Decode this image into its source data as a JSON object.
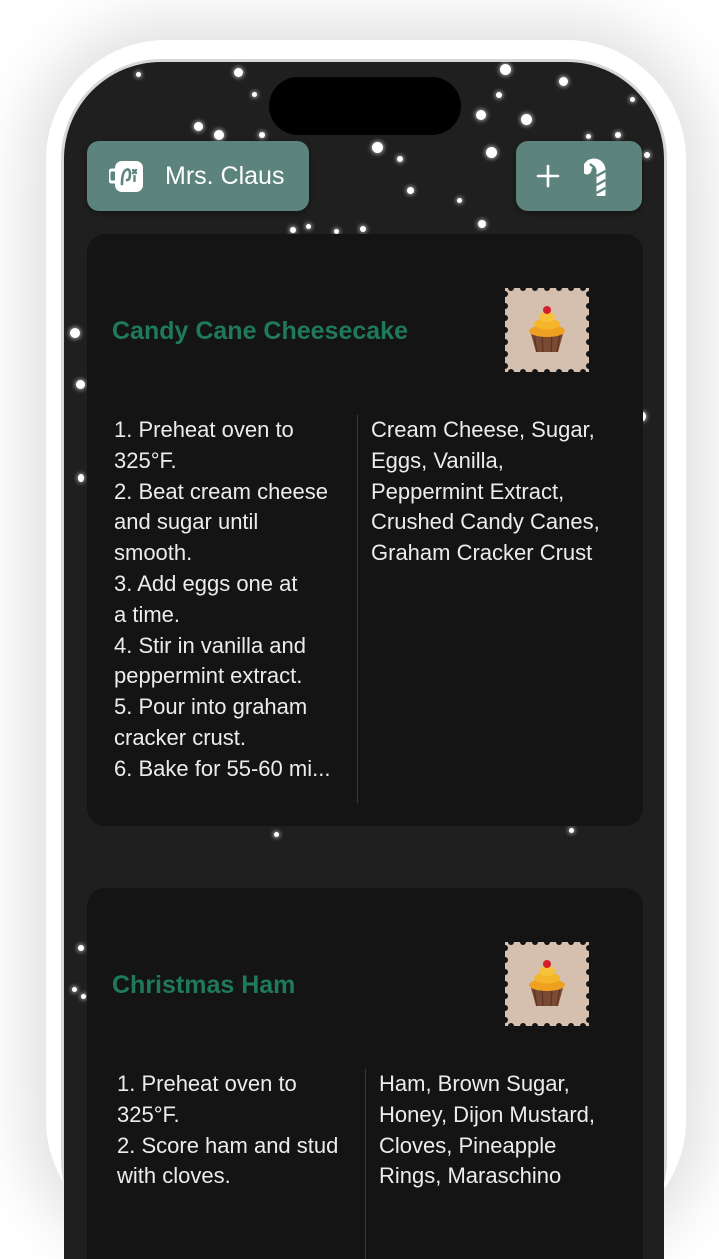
{
  "header": {
    "user_name": "Mrs. Claus",
    "user_icon": "mug-icon",
    "add_icon": "plus-icon",
    "cane_icon": "candy-cane-icon"
  },
  "colors": {
    "accent": "#5d847c",
    "title_green": "#1f7a5a",
    "card_bg": "#141414",
    "screen_bg": "#1f1f1f"
  },
  "recipes": [
    {
      "title": "Candy Cane Cheesecake",
      "icon": "cupcake-stamp-icon",
      "steps": "1. Preheat oven to 325°F.\n2. Beat cream cheese and sugar until smooth.\n3. Add eggs one at a time.\n4. Stir in vanilla and peppermint extract.\n5. Pour into graham cracker crust.\n6. Bake for 55-60 mi...",
      "ingredients": "Cream Cheese, Sugar, Eggs, Vanilla, Peppermint Extract, Crushed Candy Canes, Graham Cracker Crust"
    },
    {
      "title": "Christmas Ham",
      "icon": "cupcake-stamp-icon",
      "steps": "1. Preheat oven to 325°F.\n2. Score ham and stud with cloves.",
      "ingredients": "Ham, Brown Sugar, Honey, Dijon Mustard, Cloves, Pineapple Rings, Maraschino"
    }
  ]
}
